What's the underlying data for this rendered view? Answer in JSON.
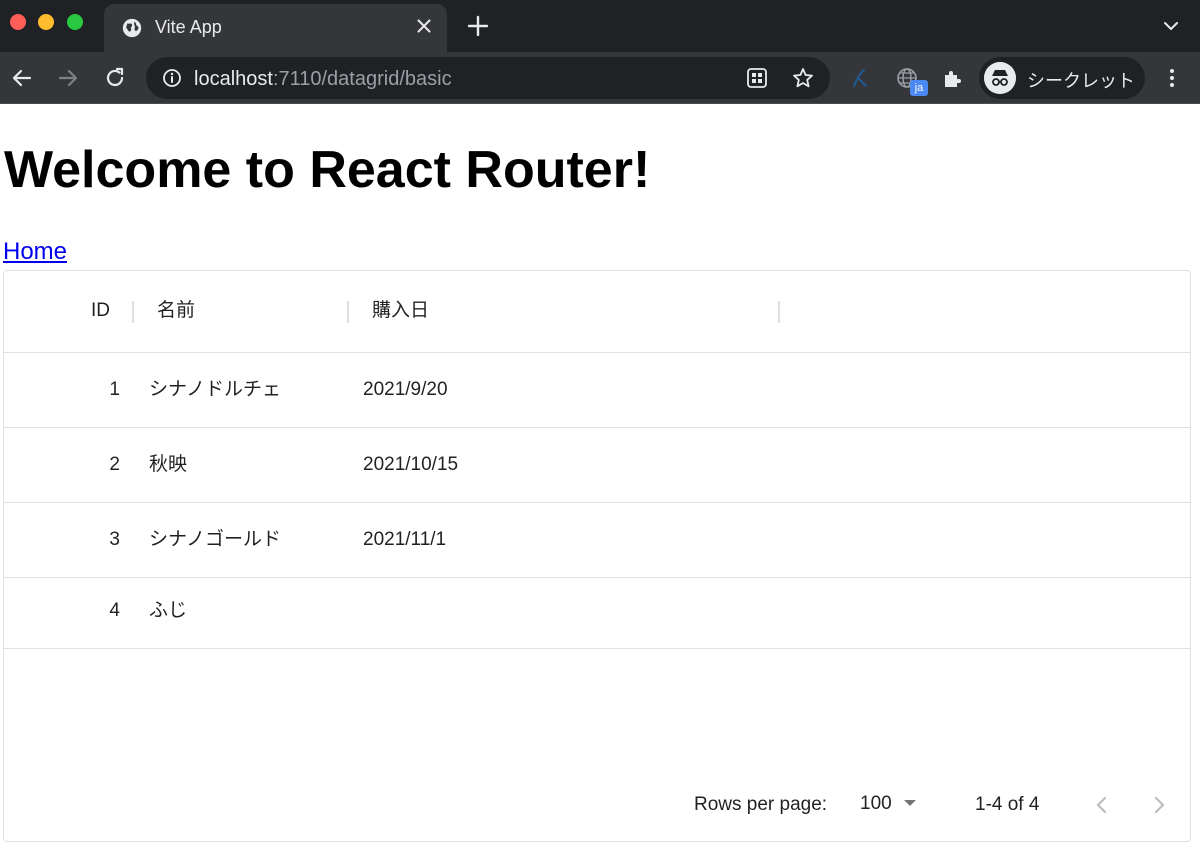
{
  "browser": {
    "tab_title": "Vite App",
    "url_host": "localhost",
    "url_path": ":7110/datagrid/basic",
    "translate_badge": "ja",
    "profile_label": "シークレット",
    "colors": {
      "chrome_dark": "#202124",
      "chrome_mid": "#35363a"
    }
  },
  "page": {
    "heading": "Welcome to React Router!",
    "home_link": "Home"
  },
  "grid": {
    "columns": [
      "ID",
      "名前",
      "購入日"
    ],
    "rows": [
      {
        "id": "1",
        "name": "シナノドルチェ",
        "date": "2021/9/20"
      },
      {
        "id": "2",
        "name": "秋映",
        "date": "2021/10/15"
      },
      {
        "id": "3",
        "name": "シナノゴールド",
        "date": "2021/11/1"
      },
      {
        "id": "4",
        "name": "ふじ",
        "date": ""
      }
    ],
    "footer": {
      "rows_per_page_label": "Rows per page:",
      "rows_per_page_value": "100",
      "range_text": "1-4 of 4"
    }
  }
}
